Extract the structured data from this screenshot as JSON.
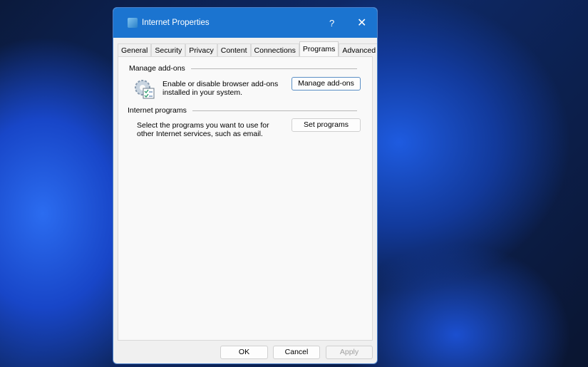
{
  "window": {
    "title": "Internet Properties",
    "help": "?",
    "close": "✕"
  },
  "tabs": [
    "General",
    "Security",
    "Privacy",
    "Content",
    "Connections",
    "Programs",
    "Advanced"
  ],
  "active_tab": "Programs",
  "addons": {
    "group": "Manage add-ons",
    "desc1": "Enable or disable browser add-ons",
    "desc2": "installed in your system.",
    "button": "Manage add-ons"
  },
  "programs": {
    "group": "Internet programs",
    "desc1": "Select the programs you want to use for",
    "desc2": "other Internet services, such as email.",
    "button": "Set programs"
  },
  "footer": {
    "ok": "OK",
    "cancel": "Cancel",
    "apply": "Apply"
  }
}
